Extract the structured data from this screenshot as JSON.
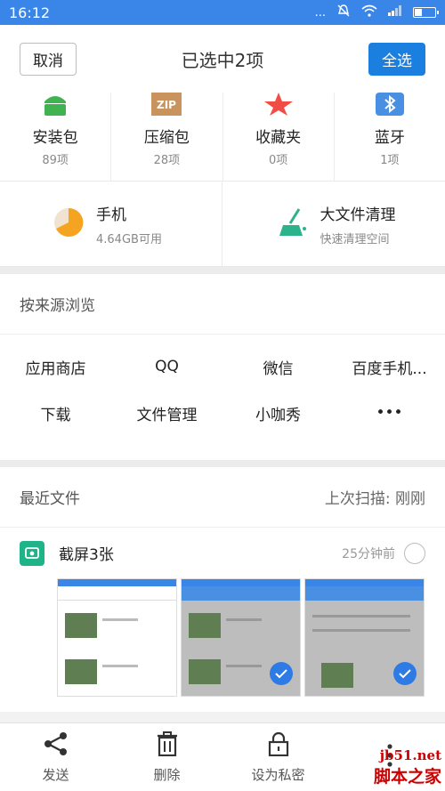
{
  "status": {
    "time": "16:12",
    "dots": "..."
  },
  "header": {
    "cancel": "取消",
    "title": "已选中2项",
    "select_all": "全选"
  },
  "categories": [
    {
      "label": "安装包",
      "count": "89项",
      "icon": "android-icon",
      "color": "#3fb34f"
    },
    {
      "label": "压缩包",
      "count": "28项",
      "icon": "zip-icon",
      "color": "#c8935c",
      "badge": "ZIP"
    },
    {
      "label": "收藏夹",
      "count": "0项",
      "icon": "star-icon",
      "color": "#f04d45"
    },
    {
      "label": "蓝牙",
      "count": "1项",
      "icon": "bluetooth-icon",
      "color": "#4a90e2"
    }
  ],
  "storage": [
    {
      "title": "手机",
      "sub": "4.64GB可用",
      "icon": "storage-pie-icon"
    },
    {
      "title": "大文件清理",
      "sub": "快速清理空间",
      "icon": "broom-icon"
    }
  ],
  "sources": {
    "title": "按来源浏览",
    "row1": [
      "应用商店",
      "QQ",
      "微信",
      "百度手机..."
    ],
    "row2": [
      "下载",
      "文件管理",
      "小咖秀",
      "•••"
    ]
  },
  "recent": {
    "title": "最近文件",
    "scan": "上次扫描: 刚刚",
    "file_name": "截屏3张",
    "file_time": "25分钟前"
  },
  "actions": [
    {
      "label": "发送",
      "icon": "share-icon"
    },
    {
      "label": "删除",
      "icon": "trash-icon"
    },
    {
      "label": "设为私密",
      "icon": "lock-icon"
    }
  ],
  "watermark": {
    "top": "jb51.net",
    "bottom": "脚本之家"
  },
  "colors": {
    "accent": "#1b7fe0",
    "status_bar": "#3a86e8",
    "green": "#1fb38a"
  }
}
